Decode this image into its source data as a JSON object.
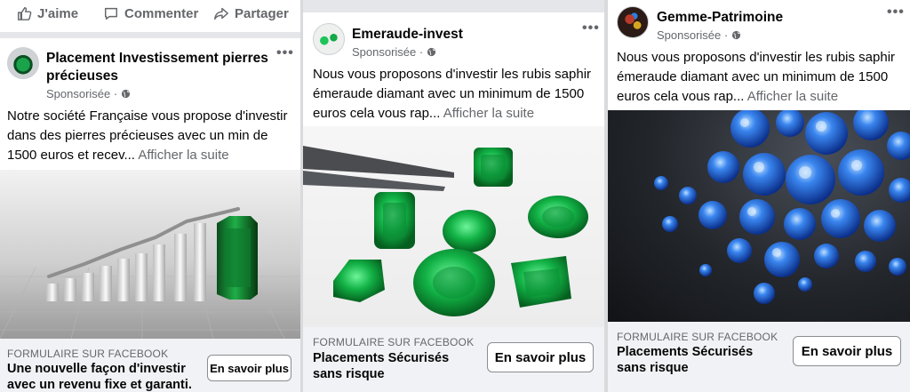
{
  "actions": {
    "like": "J'aime",
    "comment": "Commenter",
    "share": "Partager"
  },
  "ads": [
    {
      "page_name": "Placement Investissement pierres précieuses",
      "sponsored": "Sponsorisée ·",
      "text": "Notre société Française vous propose d'investir dans des pierres précieuses avec un min de 1500 euros et recev...",
      "see_more": "Afficher la suite",
      "cta_caption": "FORMULAIRE SUR FACEBOOK",
      "cta_title": "Une nouvelle façon d'investir avec un revenu fixe et garanti.",
      "cta_button": "En savoir plus"
    },
    {
      "page_name": "Emeraude-invest",
      "sponsored": "Sponsorisée ·",
      "text": "Nous vous proposons d'investir les rubis saphir émeraude diamant avec un minimum de 1500 euros cela vous rap...",
      "see_more": "Afficher la suite",
      "cta_caption": "FORMULAIRE SUR FACEBOOK",
      "cta_title": "Placements Sécurisés sans risque",
      "cta_button": "En savoir plus"
    },
    {
      "page_name": "Gemme-Patrimoine",
      "sponsored": "Sponsorisée ·",
      "text": "Nous vous proposons d'investir les rubis saphir émeraude diamant avec un minimum de 1500 euros cela vous rap...",
      "see_more": "Afficher la suite",
      "cta_caption": "FORMULAIRE SUR FACEBOOK",
      "cta_title": "Placements Sécurisés sans risque",
      "cta_button": "En savoir plus"
    }
  ],
  "icons": {
    "like": "thumbs-up-icon",
    "comment": "comment-bubble-icon",
    "share": "share-arrow-icon",
    "audience": "globe-icon",
    "more": "more-options-icon"
  },
  "colors": {
    "link_gray": "#65676b",
    "cta_bg": "#f0f2f5",
    "emerald": "#0f9d3a",
    "sapphire": "#1f5fd6"
  }
}
